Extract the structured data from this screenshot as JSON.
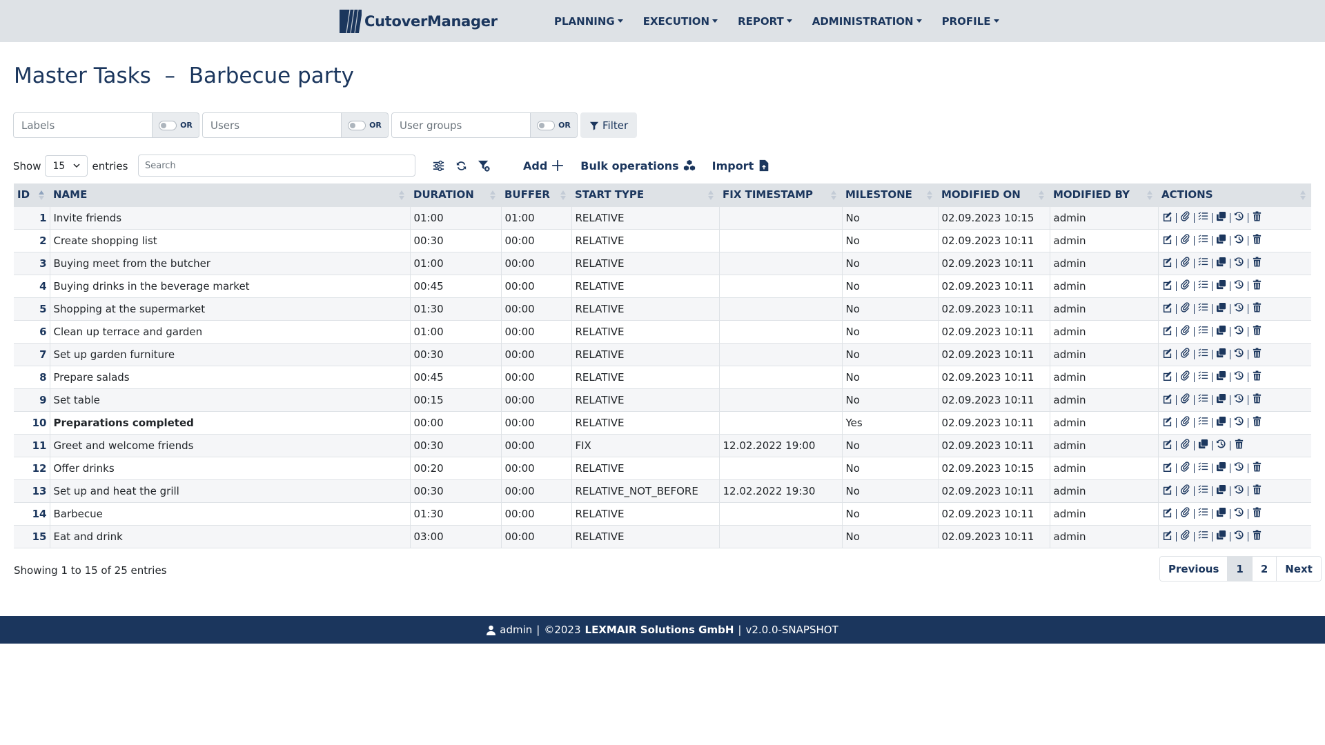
{
  "app": {
    "brand": "CutoverManager"
  },
  "nav": [
    {
      "label": "PLANNING"
    },
    {
      "label": "EXECUTION"
    },
    {
      "label": "REPORT"
    },
    {
      "label": "ADMINISTRATION"
    },
    {
      "label": "PROFILE"
    }
  ],
  "page": {
    "title": "Master Tasks  –  Barbecue party"
  },
  "filters": {
    "labels_placeholder": "Labels",
    "users_placeholder": "Users",
    "usergroups_placeholder": "User groups",
    "or_label": "OR",
    "filter_button": "Filter"
  },
  "toolbar": {
    "show_label": "Show",
    "entries_label": "entries",
    "page_size": "15",
    "search_placeholder": "Search",
    "add_label": "Add",
    "bulk_label": "Bulk operations",
    "import_label": "Import"
  },
  "table": {
    "columns": [
      "ID",
      "NAME",
      "DURATION",
      "BUFFER",
      "START TYPE",
      "FIX TIMESTAMP",
      "MILESTONE",
      "MODIFIED ON",
      "MODIFIED BY",
      "ACTIONS"
    ],
    "rows": [
      {
        "id": "1",
        "name": "Invite friends",
        "duration": "01:00",
        "buffer": "01:00",
        "start_type": "RELATIVE",
        "fix_ts": "",
        "milestone": "No",
        "modified_on": "02.09.2023 10:15",
        "modified_by": "admin",
        "bold": false,
        "actions": [
          "edit",
          "attach",
          "checklist",
          "copy",
          "history",
          "delete"
        ]
      },
      {
        "id": "2",
        "name": "Create shopping list",
        "duration": "00:30",
        "buffer": "00:00",
        "start_type": "RELATIVE",
        "fix_ts": "",
        "milestone": "No",
        "modified_on": "02.09.2023 10:11",
        "modified_by": "admin",
        "bold": false,
        "actions": [
          "edit",
          "attach",
          "checklist",
          "copy",
          "history",
          "delete"
        ]
      },
      {
        "id": "3",
        "name": "Buying meet from the butcher",
        "duration": "01:00",
        "buffer": "00:00",
        "start_type": "RELATIVE",
        "fix_ts": "",
        "milestone": "No",
        "modified_on": "02.09.2023 10:11",
        "modified_by": "admin",
        "bold": false,
        "actions": [
          "edit",
          "attach",
          "checklist",
          "copy",
          "history",
          "delete"
        ]
      },
      {
        "id": "4",
        "name": "Buying drinks in the beverage market",
        "duration": "00:45",
        "buffer": "00:00",
        "start_type": "RELATIVE",
        "fix_ts": "",
        "milestone": "No",
        "modified_on": "02.09.2023 10:11",
        "modified_by": "admin",
        "bold": false,
        "actions": [
          "edit",
          "attach",
          "checklist",
          "copy",
          "history",
          "delete"
        ]
      },
      {
        "id": "5",
        "name": "Shopping at the supermarket",
        "duration": "01:30",
        "buffer": "00:00",
        "start_type": "RELATIVE",
        "fix_ts": "",
        "milestone": "No",
        "modified_on": "02.09.2023 10:11",
        "modified_by": "admin",
        "bold": false,
        "actions": [
          "edit",
          "attach",
          "checklist",
          "copy",
          "history",
          "delete"
        ]
      },
      {
        "id": "6",
        "name": "Clean up terrace and garden",
        "duration": "01:00",
        "buffer": "00:00",
        "start_type": "RELATIVE",
        "fix_ts": "",
        "milestone": "No",
        "modified_on": "02.09.2023 10:11",
        "modified_by": "admin",
        "bold": false,
        "actions": [
          "edit",
          "attach",
          "checklist",
          "copy",
          "history",
          "delete"
        ]
      },
      {
        "id": "7",
        "name": "Set up garden furniture",
        "duration": "00:30",
        "buffer": "00:00",
        "start_type": "RELATIVE",
        "fix_ts": "",
        "milestone": "No",
        "modified_on": "02.09.2023 10:11",
        "modified_by": "admin",
        "bold": false,
        "actions": [
          "edit",
          "attach",
          "checklist",
          "copy",
          "history",
          "delete"
        ]
      },
      {
        "id": "8",
        "name": "Prepare salads",
        "duration": "00:45",
        "buffer": "00:00",
        "start_type": "RELATIVE",
        "fix_ts": "",
        "milestone": "No",
        "modified_on": "02.09.2023 10:11",
        "modified_by": "admin",
        "bold": false,
        "actions": [
          "edit",
          "attach",
          "checklist",
          "copy",
          "history",
          "delete"
        ]
      },
      {
        "id": "9",
        "name": "Set table",
        "duration": "00:15",
        "buffer": "00:00",
        "start_type": "RELATIVE",
        "fix_ts": "",
        "milestone": "No",
        "modified_on": "02.09.2023 10:11",
        "modified_by": "admin",
        "bold": false,
        "actions": [
          "edit",
          "attach",
          "checklist",
          "copy",
          "history",
          "delete"
        ]
      },
      {
        "id": "10",
        "name": "Preparations completed",
        "duration": "00:00",
        "buffer": "00:00",
        "start_type": "RELATIVE",
        "fix_ts": "",
        "milestone": "Yes",
        "modified_on": "02.09.2023 10:11",
        "modified_by": "admin",
        "bold": true,
        "actions": [
          "edit",
          "attach",
          "checklist",
          "copy",
          "history",
          "delete"
        ]
      },
      {
        "id": "11",
        "name": "Greet and welcome friends",
        "duration": "00:30",
        "buffer": "00:00",
        "start_type": "FIX",
        "fix_ts": "12.02.2022 19:00",
        "milestone": "No",
        "modified_on": "02.09.2023 10:11",
        "modified_by": "admin",
        "bold": false,
        "actions": [
          "edit",
          "attach",
          "copy",
          "history",
          "delete"
        ]
      },
      {
        "id": "12",
        "name": "Offer drinks",
        "duration": "00:20",
        "buffer": "00:00",
        "start_type": "RELATIVE",
        "fix_ts": "",
        "milestone": "No",
        "modified_on": "02.09.2023 10:15",
        "modified_by": "admin",
        "bold": false,
        "actions": [
          "edit",
          "attach",
          "checklist",
          "copy",
          "history",
          "delete"
        ]
      },
      {
        "id": "13",
        "name": "Set up and heat the grill",
        "duration": "00:30",
        "buffer": "00:00",
        "start_type": "RELATIVE_NOT_BEFORE",
        "fix_ts": "12.02.2022 19:30",
        "milestone": "No",
        "modified_on": "02.09.2023 10:11",
        "modified_by": "admin",
        "bold": false,
        "actions": [
          "edit",
          "attach",
          "checklist",
          "copy",
          "history",
          "delete"
        ]
      },
      {
        "id": "14",
        "name": "Barbecue",
        "duration": "01:30",
        "buffer": "00:00",
        "start_type": "RELATIVE",
        "fix_ts": "",
        "milestone": "No",
        "modified_on": "02.09.2023 10:11",
        "modified_by": "admin",
        "bold": false,
        "actions": [
          "edit",
          "attach",
          "checklist",
          "copy",
          "history",
          "delete"
        ]
      },
      {
        "id": "15",
        "name": "Eat and drink",
        "duration": "03:00",
        "buffer": "00:00",
        "start_type": "RELATIVE",
        "fix_ts": "",
        "milestone": "No",
        "modified_on": "02.09.2023 10:11",
        "modified_by": "admin",
        "bold": false,
        "actions": [
          "edit",
          "attach",
          "checklist",
          "copy",
          "history",
          "delete"
        ]
      }
    ]
  },
  "pagination": {
    "info": "Showing 1 to 15 of 25 entries",
    "previous": "Previous",
    "pages": [
      "1",
      "2"
    ],
    "active_page": "1",
    "next": "Next"
  },
  "footer": {
    "user": "admin",
    "copyright": "©2023",
    "company": "LEXMAIR Solutions GmbH",
    "version": "v2.0.0-SNAPSHOT",
    "separator": "|"
  },
  "colors": {
    "brand": "#1b365d",
    "navbar_bg": "#dee2e6",
    "footer_bg": "#1b365d"
  }
}
